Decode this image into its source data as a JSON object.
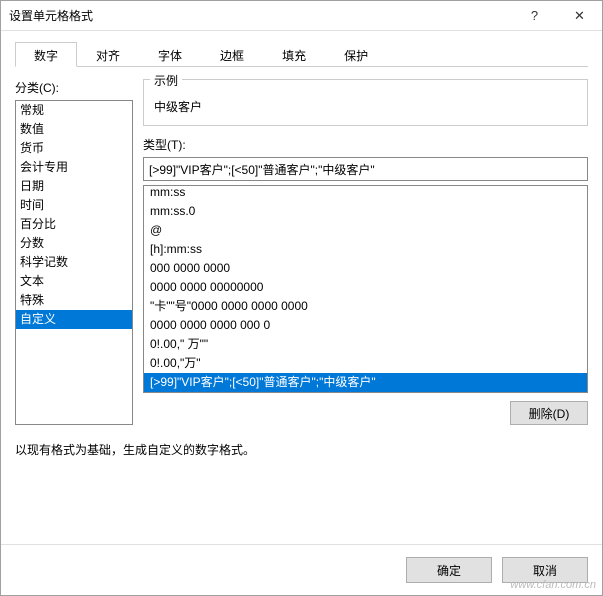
{
  "title": "设置单元格格式",
  "tabs": [
    "数字",
    "对齐",
    "字体",
    "边框",
    "填充",
    "保护"
  ],
  "active_tab": 0,
  "category_label": "分类(C):",
  "categories": [
    "常规",
    "数值",
    "货币",
    "会计专用",
    "日期",
    "时间",
    "百分比",
    "分数",
    "科学记数",
    "文本",
    "特殊",
    "自定义"
  ],
  "selected_category": 11,
  "sample_label": "示例",
  "sample_value": "中级客户",
  "type_label": "类型(T):",
  "type_input_value": "[>99]\"VIP客户\";[<50]\"普通客户\";\"中级客户\"",
  "type_list": [
    "mm:ss",
    "mm:ss.0",
    "@",
    "[h]:mm:ss",
    "000 0000 0000",
    "0000 0000 00000000",
    "\"卡\"\"号\"0000 0000 0000 0000",
    "0000 0000 0000 000 0",
    "0!.00,\" 万\"\"",
    "0!.00,\"万\"",
    "[>99]\"VIP客户\";[<50]\"普通客户\";\"中级客户\""
  ],
  "selected_type": 10,
  "delete_label": "删除(D)",
  "desc": "以现有格式为基础，生成自定义的数字格式。",
  "ok_label": "确定",
  "cancel_label": "取消",
  "watermark": "www.cfan.com.cn"
}
